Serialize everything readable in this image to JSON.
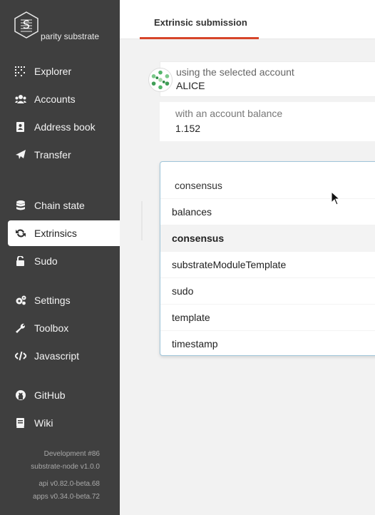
{
  "logo": {
    "text": "parity substrate"
  },
  "sidebar": {
    "items": [
      {
        "label": "Explorer",
        "icon": "explorer-grid-icon"
      },
      {
        "label": "Accounts",
        "icon": "users-icon"
      },
      {
        "label": "Address book",
        "icon": "address-book-icon"
      },
      {
        "label": "Transfer",
        "icon": "paper-plane-icon"
      },
      {
        "label": "Chain state",
        "icon": "database-icon"
      },
      {
        "label": "Extrinsics",
        "icon": "sync-icon",
        "active": true
      },
      {
        "label": "Sudo",
        "icon": "unlock-icon"
      },
      {
        "label": "Settings",
        "icon": "cogs-icon"
      },
      {
        "label": "Toolbox",
        "icon": "wrench-icon"
      },
      {
        "label": "Javascript",
        "icon": "code-icon"
      },
      {
        "label": "GitHub",
        "icon": "github-icon"
      },
      {
        "label": "Wiki",
        "icon": "book-icon"
      }
    ],
    "footer": {
      "chain": "Development #86",
      "node": "substrate-node v1.0.0",
      "api": "api v0.82.0-beta.68",
      "apps": "apps v0.34.0-beta.72"
    }
  },
  "header": {
    "tab_label": "Extrinsic submission"
  },
  "account": {
    "label": "using the selected account",
    "value": "ALICE"
  },
  "balance": {
    "label": "with an account balance",
    "value": "1.152"
  },
  "module_dropdown": {
    "current": "consensus",
    "options": [
      {
        "label": "balances"
      },
      {
        "label": "consensus",
        "selected": true
      },
      {
        "label": "substrateModuleTemplate"
      },
      {
        "label": "sudo"
      },
      {
        "label": "template"
      },
      {
        "label": "timestamp"
      }
    ]
  },
  "colors": {
    "sidebar": "#3f3f3f",
    "accent": "#d7452a",
    "dropdown_border": "#9fc5d9"
  }
}
